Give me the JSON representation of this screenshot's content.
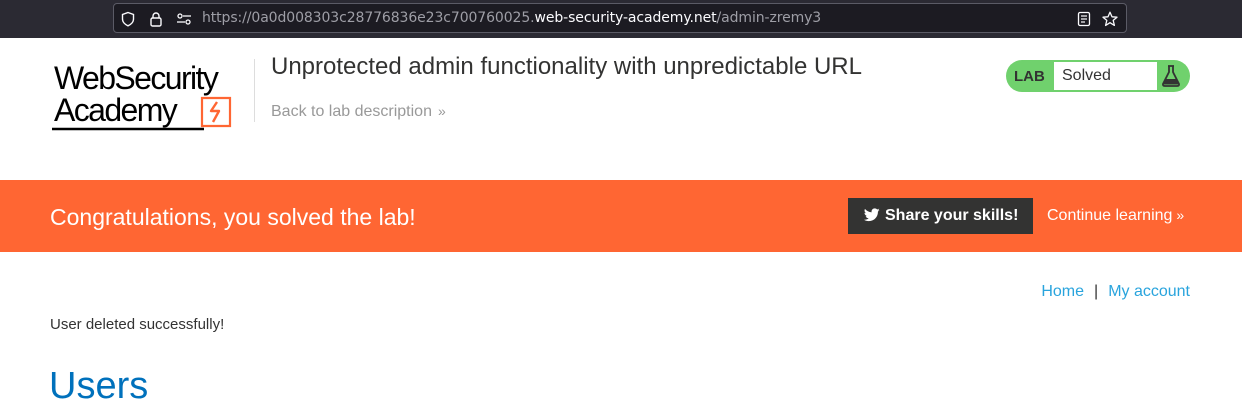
{
  "browser": {
    "url_prefix": "https://0a0d008303c28776836e23c700760025.",
    "url_host": "web-security-academy.net",
    "url_path": "/admin-zremy3",
    "icons": [
      "shield-icon",
      "lock-icon",
      "site-permissions-icon",
      "reader-view-icon",
      "bookmark-star-icon"
    ]
  },
  "header": {
    "logo_line1": "WebSecurity",
    "logo_line2": "Academy",
    "lab_title": "Unprotected admin functionality with unpredictable URL",
    "back_link": "Back to lab description",
    "lab_status": {
      "label": "LAB",
      "value": "Solved",
      "color": "#70d16d"
    }
  },
  "banner": {
    "message": "Congratulations, you solved the lab!",
    "share_button": "Share your skills!",
    "continue_link": "Continue learning",
    "color": "#ff6633"
  },
  "nav": {
    "home": "Home",
    "separator": "|",
    "my_account": "My account"
  },
  "main": {
    "status_message": "User deleted successfully!",
    "heading": "Users"
  }
}
